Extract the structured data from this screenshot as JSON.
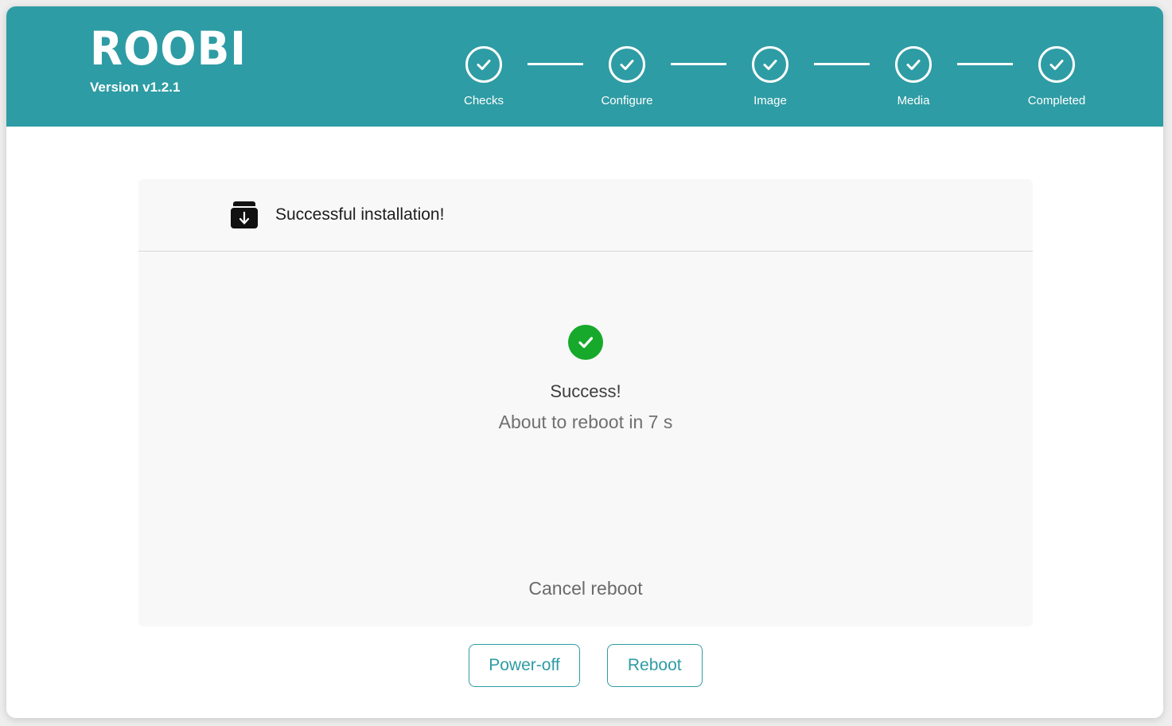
{
  "header": {
    "brand_title": "ROOBI",
    "brand_version": "Version v1.2.1",
    "background_color": "#2e9ca4",
    "steps": [
      {
        "label": "Checks",
        "state": "completed",
        "icon": "check-circle-icon"
      },
      {
        "label": "Configure",
        "state": "completed",
        "icon": "check-circle-icon"
      },
      {
        "label": "Image",
        "state": "completed",
        "icon": "check-circle-icon"
      },
      {
        "label": "Media",
        "state": "completed",
        "icon": "check-circle-icon"
      },
      {
        "label": "Completed",
        "state": "completed",
        "icon": "check-circle-icon"
      }
    ]
  },
  "card": {
    "icon": "install-package-icon",
    "title": "Successful installation!",
    "status": {
      "icon": "success-check-icon",
      "icon_color": "#17a92b",
      "title": "Success!",
      "subtitle": "About to reboot in 7 s",
      "countdown_seconds": "7"
    },
    "cancel_label": "Cancel reboot"
  },
  "footer": {
    "power_off_label": "Power-off",
    "reboot_label": "Reboot",
    "accent_color": "#2e9ca4"
  }
}
